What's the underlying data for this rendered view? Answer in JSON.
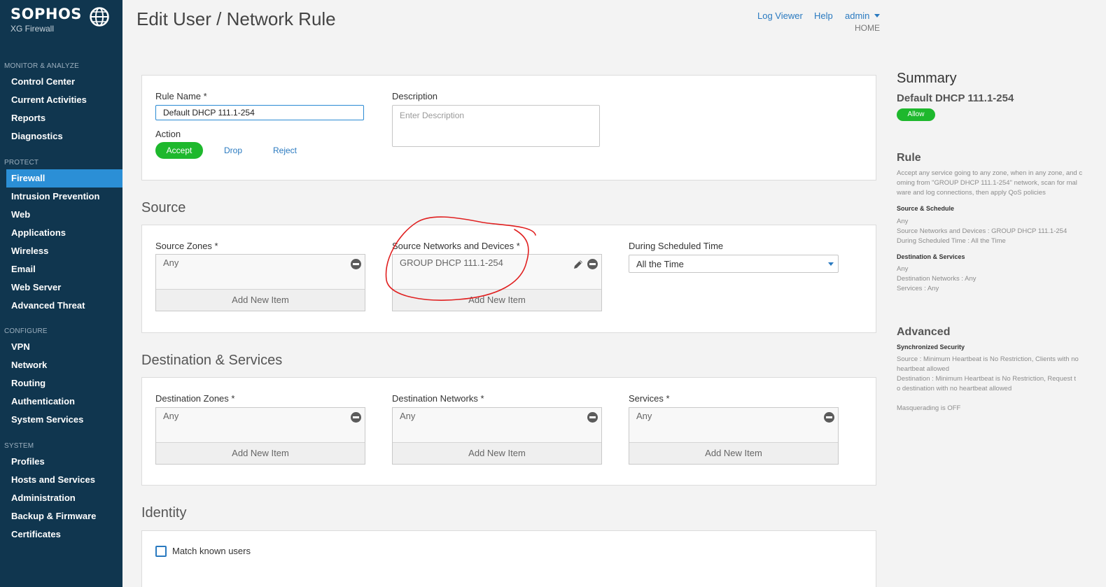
{
  "sidebar": {
    "brand": "SOPHOS",
    "product": "XG Firewall",
    "sections": [
      {
        "heading": "MONITOR & ANALYZE",
        "items": [
          "Control Center",
          "Current Activities",
          "Reports",
          "Diagnostics"
        ]
      },
      {
        "heading": "PROTECT",
        "items": [
          "Firewall",
          "Intrusion Prevention",
          "Web",
          "Applications",
          "Wireless",
          "Email",
          "Web Server",
          "Advanced Threat"
        ]
      },
      {
        "heading": "CONFIGURE",
        "items": [
          "VPN",
          "Network",
          "Routing",
          "Authentication",
          "System Services"
        ]
      },
      {
        "heading": "SYSTEM",
        "items": [
          "Profiles",
          "Hosts and Services",
          "Administration",
          "Backup & Firmware",
          "Certificates"
        ]
      }
    ],
    "active": "Firewall"
  },
  "header": {
    "title": "Edit User / Network Rule",
    "log_viewer": "Log Viewer",
    "help": "Help",
    "admin": "admin",
    "home": "HOME"
  },
  "rule": {
    "name_label": "Rule Name *",
    "name_value": "Default DHCP 111.1-254",
    "description_label": "Description",
    "description_placeholder": "Enter Description",
    "action_label": "Action",
    "accept": "Accept",
    "drop": "Drop",
    "reject": "Reject"
  },
  "source": {
    "title": "Source",
    "zones_label": "Source Zones *",
    "zones_value": "Any",
    "networks_label": "Source Networks and Devices *",
    "networks_value": "GROUP DHCP 111.1-254",
    "schedule_label": "During Scheduled Time",
    "schedule_value": "All the Time",
    "add_new": "Add New Item"
  },
  "destination": {
    "title": "Destination & Services",
    "zones_label": "Destination Zones *",
    "zones_value": "Any",
    "networks_label": "Destination Networks *",
    "networks_value": "Any",
    "services_label": "Services *",
    "services_value": "Any",
    "add_new": "Add New Item"
  },
  "identity": {
    "title": "Identity",
    "match_known_users": "Match known users"
  },
  "summary": {
    "title": "Summary",
    "rule_name": "Default DHCP 111.1-254",
    "status": "Allow",
    "rule_heading": "Rule",
    "rule_desc_1": "Accept any service going to any zone, when in any zone, and c",
    "rule_desc_2": "oming from \"GROUP DHCP 111.1-254\" network, scan for mal",
    "rule_desc_3": "ware and log connections, then apply QoS policies",
    "source_schedule": "Source & Schedule",
    "src_any": "Any",
    "src_networks": "Source Networks and Devices : GROUP DHCP 111.1-254",
    "src_time": "During Scheduled Time : All the Time",
    "dest_services": "Destination & Services",
    "dst_any": "Any",
    "dst_networks": "Destination Networks : Any",
    "dst_services": "Services : Any",
    "advanced_heading": "Advanced",
    "sync_security": "Synchronized Security",
    "adv_src_1": "Source : Minimum Heartbeat is No Restriction, Clients with no",
    "adv_src_2": "heartbeat allowed",
    "adv_dst_1": "Destination : Minimum Heartbeat is No Restriction, Request t",
    "adv_dst_2": "o destination with no heartbeat allowed",
    "masquerading": "Masquerading is OFF"
  },
  "colors": {
    "sidebar_bg": "#10364f",
    "active_item": "#2b8fd6",
    "accent_green": "#1eb82d",
    "link_blue": "#2a7ac0",
    "annotation_red": "#e02020"
  }
}
